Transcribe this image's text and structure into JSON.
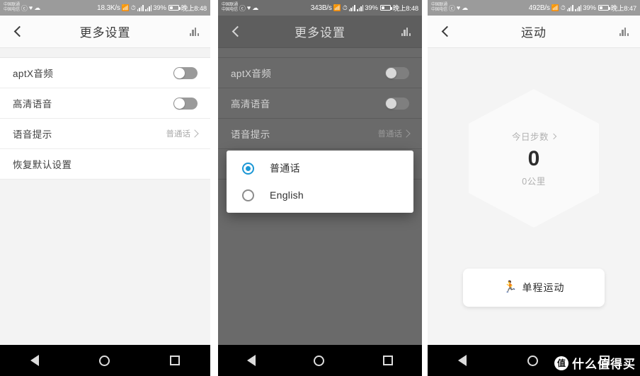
{
  "panels": [
    {
      "id": "settings-normal",
      "statusbar": {
        "carrier_line1": "中国联通",
        "carrier_line2": "中国电信",
        "speed": "18.3K/s",
        "battery": "39%",
        "time": "晚上8:48"
      },
      "appbar": {
        "title": "更多设置"
      },
      "rows": [
        {
          "label": "aptX音频",
          "control": "switch",
          "value": ""
        },
        {
          "label": "高清语音",
          "control": "switch",
          "value": ""
        },
        {
          "label": "语音提示",
          "control": "value",
          "value": "普通话"
        },
        {
          "label": "恢复默认设置",
          "control": "none",
          "value": ""
        }
      ]
    },
    {
      "id": "settings-dialog",
      "statusbar": {
        "carrier_line1": "中国联通",
        "carrier_line2": "中国电信",
        "speed": "343B/s",
        "battery": "39%",
        "time": "晚上8:48"
      },
      "appbar": {
        "title": "更多设置"
      },
      "rows": [
        {
          "label": "aptX音频",
          "control": "switch",
          "value": ""
        },
        {
          "label": "高清语音",
          "control": "switch",
          "value": ""
        },
        {
          "label": "语音提示",
          "control": "value",
          "value": "普通话"
        }
      ],
      "dialog": {
        "options": [
          {
            "label": "普通话",
            "selected": true
          },
          {
            "label": "English",
            "selected": false
          }
        ]
      }
    },
    {
      "id": "sport",
      "statusbar": {
        "carrier_line1": "中国联通",
        "carrier_line2": "中国电信",
        "speed": "492B/s",
        "battery": "39%",
        "time": "晚上8:47"
      },
      "appbar": {
        "title": "运动"
      },
      "hex": {
        "label": "今日步数",
        "value": "0",
        "sub": "0公里"
      },
      "action_button": {
        "icon": "🏃",
        "label": "单程运动"
      }
    }
  ],
  "navbar": {
    "back": "back-triangle",
    "home": "home-circle",
    "recents": "square"
  },
  "watermark": {
    "badge": "值",
    "text": "什么值得买"
  },
  "colors": {
    "accent": "#1b97d5",
    "statusbar": "#9b9b9b",
    "dim_overlay": "#6a6a6a"
  }
}
